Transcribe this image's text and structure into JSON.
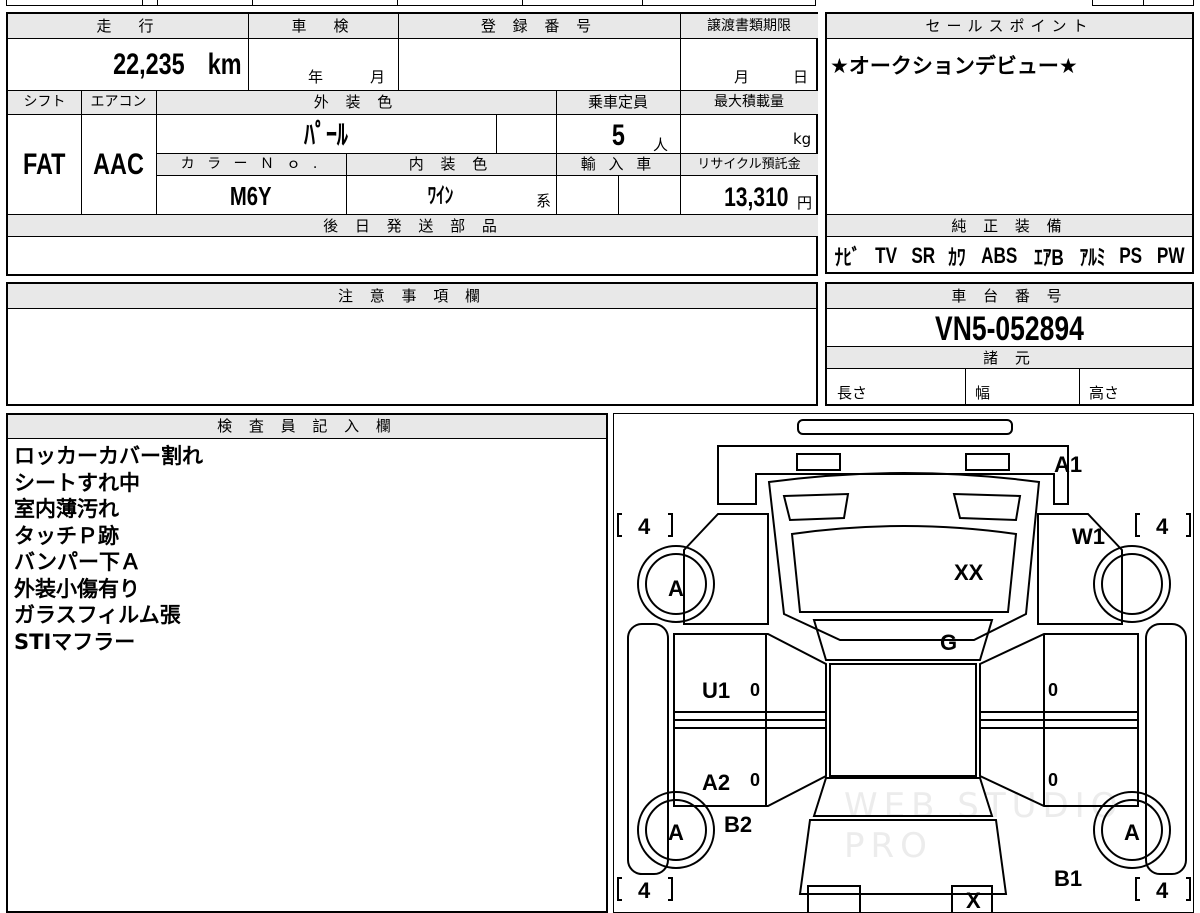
{
  "top_block": {
    "headers": {
      "mileage": "走　行",
      "shaken": "車　検",
      "reg_number": "登 録 番 号",
      "transfer_deadline": "譲渡書類期限",
      "shift": "シフト",
      "aircon": "エアコン",
      "exterior_color": "外 装 色",
      "capacity": "乗車定員",
      "max_load": "最大積載量",
      "color_no": "カ ラ ー Ｎ ｏ .",
      "interior_color": "内 装 色",
      "import": "輸 入 車",
      "recycle_fee": "リサイクル預託金",
      "later_parts": "後 日 発 送 部 品"
    },
    "values": {
      "mileage": "22,235",
      "mileage_unit": "km",
      "shaken_year": "年",
      "shaken_month": "月",
      "deadline_month": "月",
      "deadline_day": "日",
      "shift": "FAT",
      "aircon": "AAC",
      "exterior_color": "ﾊﾟｰﾙ",
      "capacity": "5",
      "capacity_unit": "人",
      "max_load_unit": "kg",
      "color_no": "M6Y",
      "interior_color": "ﾜｲﾝ",
      "interior_suffix": "系",
      "recycle_fee": "13,310",
      "recycle_unit": "円"
    }
  },
  "sales_points": {
    "header": "セールスポイント",
    "text": "★オークションデビュー★"
  },
  "genuine_equipment": {
    "header": "純 正 装 備",
    "items": [
      "ﾅﾋﾞ",
      "TV",
      "SR",
      "ｶﾜ",
      "ABS",
      "ｴｱB",
      "ｱﾙﾐ",
      "PS",
      "PW"
    ]
  },
  "notes": {
    "header": "注 意 事 項 欄"
  },
  "chassis": {
    "header": "車 台 番 号",
    "number": "VN5-052894"
  },
  "specs": {
    "header": "諸 元",
    "length": "長さ",
    "width": "幅",
    "height": "高さ"
  },
  "inspector": {
    "header": "検 査 員 記 入 欄",
    "remarks": [
      "ロッカーカバー割れ",
      "シートすれ中",
      "室内薄汚れ",
      "タッチＰ跡",
      "バンパー下Ａ",
      "外装小傷有り",
      "ガラスフィルム張",
      "STIマフラー"
    ]
  },
  "diagram": {
    "marks": {
      "a1": "A1",
      "w1": "W1",
      "xx": "XX",
      "g": "G",
      "u1": "U1",
      "a2": "A2",
      "b2": "B2",
      "b1": "B1",
      "x": "X",
      "tire_fl": "A",
      "tire_rl": "A",
      "tire_rr": "A",
      "tire_fr_count": "4",
      "tire_fl_count": "4",
      "tire_rl_count": "4",
      "tire_rr_count": "4",
      "zero_1": "0",
      "zero_2": "0",
      "zero_3": "0",
      "zero_4": "0"
    },
    "watermark": "WEB STUDIO PRO"
  }
}
